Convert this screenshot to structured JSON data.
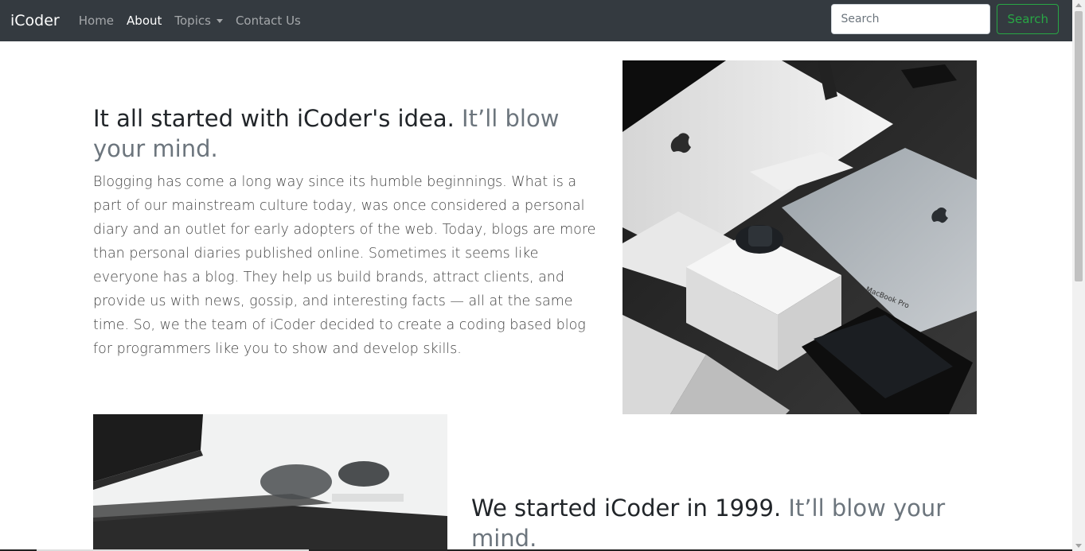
{
  "navbar": {
    "brand": "iCoder",
    "links": [
      {
        "label": "Home"
      },
      {
        "label": "About"
      },
      {
        "label": "Topics"
      },
      {
        "label": "Contact Us"
      }
    ],
    "search": {
      "placeholder": "Search",
      "value": "",
      "button_label": "Search"
    }
  },
  "featurette1": {
    "heading": "It all started with iCoder's idea.",
    "heading_muted": "It’ll blow your mind.",
    "body": "Blogging has come a long way since its humble beginnings. What is a part of our mainstream culture today, was once considered a personal diary and an outlet for early adopters of the web. Today, blogs are more than personal diaries published online. Sometimes it seems like everyone has a blog. They help us build brands, attract clients, and provide us with news, gossip, and interesting facts — all at the same time. So, we the team of iCoder decided to create a coding based blog for programmers like you to show and develop skills."
  },
  "featurette2": {
    "heading": "We started iCoder in 1999.",
    "heading_muted": "It’ll blow your mind."
  },
  "images": {
    "img1_label": "MacBook Pro"
  },
  "colors": {
    "navbar_bg": "#343a40",
    "search_accent": "#28a745",
    "muted_text": "#6c757d"
  }
}
